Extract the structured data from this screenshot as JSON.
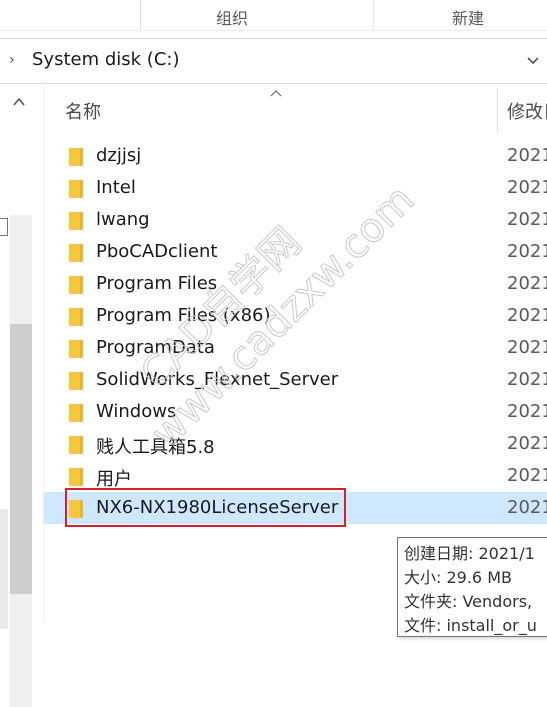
{
  "ribbon": {
    "group1": "组织",
    "group2": "新建"
  },
  "address": {
    "path": "System disk (C:)"
  },
  "columns": {
    "name": "名称",
    "date": "修改日"
  },
  "files": [
    {
      "name": "dzjjsj",
      "date": "2021"
    },
    {
      "name": "Intel",
      "date": "2021"
    },
    {
      "name": "lwang",
      "date": "2021"
    },
    {
      "name": "PboCADclient",
      "date": "2021"
    },
    {
      "name": "Program Files",
      "date": "2021"
    },
    {
      "name": "Program Files (x86)",
      "date": "2021"
    },
    {
      "name": "ProgramData",
      "date": "2021"
    },
    {
      "name": "SolidWorks_Flexnet_Server",
      "date": "2021"
    },
    {
      "name": "Windows",
      "date": "2021"
    },
    {
      "name": "贱人工具箱5.8",
      "date": "2021"
    },
    {
      "name": "用户",
      "date": "2021"
    },
    {
      "name": "NX6-NX1980LicenseServer",
      "date": "2021",
      "selected": true
    }
  ],
  "tooltip": {
    "created": "创建日期: 2021/1",
    "size": "大小: 29.6 MB",
    "folders": "文件夹: Vendors, ",
    "files": "文件: install_or_u"
  },
  "watermark": {
    "line1": "CAD自学网",
    "line2": "www.cadzxw.com"
  },
  "colors": {
    "selection": "#cde8ff",
    "highlight_border": "#d6202a",
    "folder": "#f5c73d"
  },
  "icons": {
    "address_prefix": "chevron-right-icon",
    "address_dropdown": "chevron-down-icon",
    "sort": "sort-ascending-icon",
    "folder": "folder-icon"
  }
}
